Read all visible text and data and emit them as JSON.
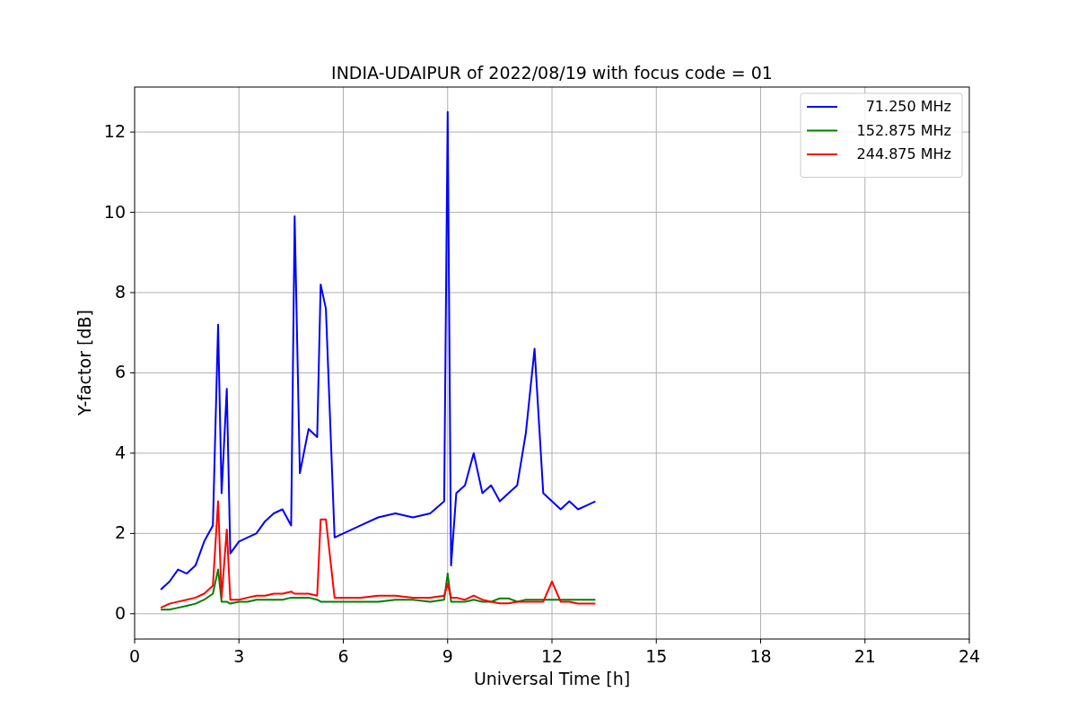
{
  "figure": {
    "chart_data": {
      "type": "line",
      "title": "INDIA-UDAIPUR of 2022/08/19 with focus code = 01",
      "xlabel": "Universal Time [h]",
      "ylabel": "Y-factor [dB]",
      "x": [
        0.75,
        1.0,
        1.25,
        1.5,
        1.75,
        2.0,
        2.25,
        2.4,
        2.5,
        2.65,
        2.75,
        3.0,
        3.25,
        3.5,
        3.75,
        4.0,
        4.25,
        4.5,
        4.6,
        4.75,
        5.0,
        5.25,
        5.35,
        5.5,
        5.75,
        6.0,
        6.5,
        7.0,
        7.5,
        8.0,
        8.5,
        8.9,
        9.0,
        9.1,
        9.25,
        9.5,
        9.75,
        10.0,
        10.25,
        10.5,
        10.75,
        11.0,
        11.25,
        11.5,
        11.75,
        12.0,
        12.25,
        12.5,
        12.75,
        13.0,
        13.25
      ],
      "series": [
        {
          "name": "71.250 MHz",
          "color": "#0000ff",
          "values": [
            0.6,
            0.8,
            1.1,
            1.0,
            1.2,
            1.8,
            2.2,
            7.2,
            3.0,
            5.6,
            1.5,
            1.8,
            1.9,
            2.0,
            2.3,
            2.5,
            2.6,
            2.2,
            9.9,
            3.5,
            4.6,
            4.4,
            8.2,
            7.6,
            1.9,
            2.0,
            2.2,
            2.4,
            2.5,
            2.4,
            2.5,
            2.8,
            12.5,
            1.2,
            3.0,
            3.2,
            4.0,
            3.0,
            3.2,
            2.8,
            3.0,
            3.2,
            4.5,
            6.6,
            3.0,
            2.8,
            2.6,
            2.8,
            2.6,
            2.7,
            2.8
          ]
        },
        {
          "name": "152.875 MHz",
          "color": "#008000",
          "values": [
            0.1,
            0.1,
            0.15,
            0.2,
            0.25,
            0.35,
            0.5,
            1.1,
            0.3,
            0.3,
            0.25,
            0.3,
            0.3,
            0.35,
            0.35,
            0.35,
            0.35,
            0.4,
            0.4,
            0.4,
            0.4,
            0.35,
            0.3,
            0.3,
            0.3,
            0.3,
            0.3,
            0.3,
            0.35,
            0.35,
            0.3,
            0.35,
            1.0,
            0.3,
            0.3,
            0.3,
            0.35,
            0.3,
            0.3,
            0.38,
            0.38,
            0.3,
            0.35,
            0.35,
            0.35,
            0.35,
            0.35,
            0.35,
            0.35,
            0.35,
            0.35
          ]
        },
        {
          "name": "244.875 MHz",
          "color": "#ff0000",
          "values": [
            0.15,
            0.25,
            0.3,
            0.35,
            0.4,
            0.5,
            0.7,
            2.8,
            0.4,
            2.1,
            0.35,
            0.35,
            0.4,
            0.45,
            0.45,
            0.5,
            0.5,
            0.55,
            0.5,
            0.5,
            0.5,
            0.45,
            2.35,
            2.35,
            0.4,
            0.4,
            0.4,
            0.45,
            0.45,
            0.4,
            0.4,
            0.45,
            0.75,
            0.4,
            0.4,
            0.35,
            0.45,
            0.35,
            0.3,
            0.26,
            0.26,
            0.3,
            0.3,
            0.3,
            0.3,
            0.8,
            0.3,
            0.3,
            0.25,
            0.25,
            0.25
          ]
        }
      ],
      "grid": true,
      "legend": true,
      "xlim": [
        0,
        24
      ],
      "ylim": [
        -0.63,
        13.12
      ],
      "xticks": [
        0,
        3,
        6,
        9,
        12,
        15,
        18,
        21,
        24
      ],
      "yticks": [
        0,
        2,
        4,
        6,
        8,
        10,
        12
      ]
    }
  }
}
